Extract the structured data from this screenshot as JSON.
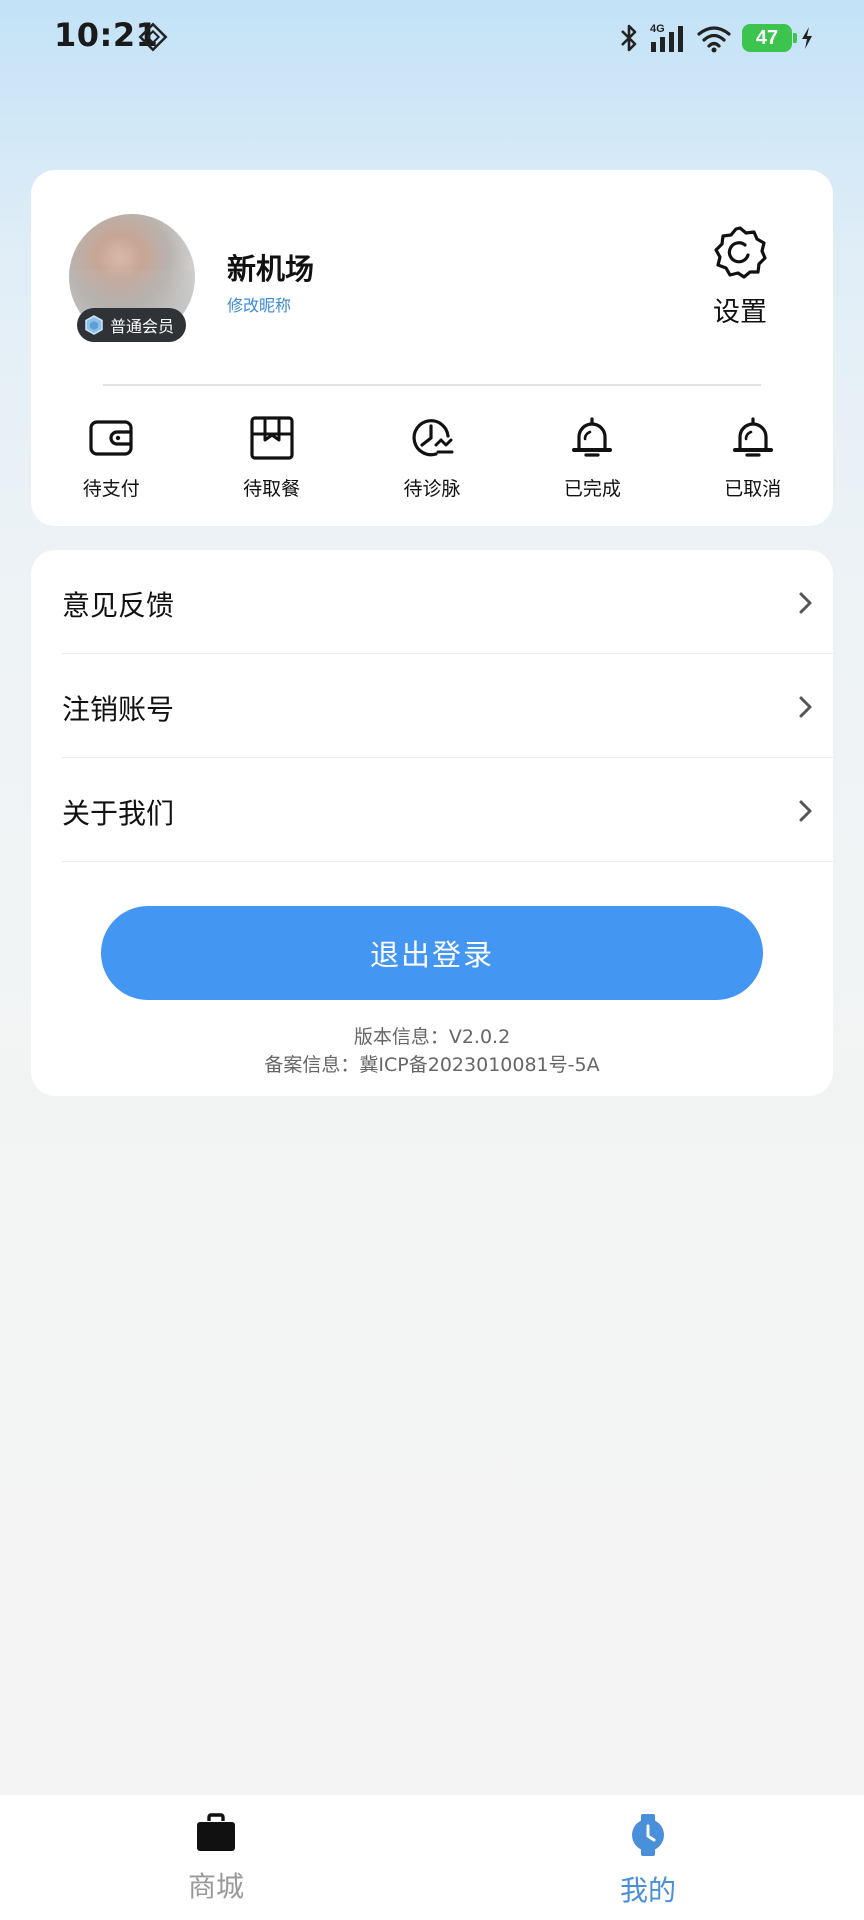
{
  "status_bar": {
    "time": "10:21",
    "network": "4G",
    "battery": "47",
    "icons": [
      "signal-extra-icon",
      "bluetooth-icon",
      "cellular-signal-icon",
      "wifi-icon",
      "battery-icon",
      "charging-icon"
    ]
  },
  "profile": {
    "nickname": "新机场",
    "edit_nickname": "修改昵称",
    "member_badge": "普通会员",
    "settings_label": "设置"
  },
  "orders": [
    {
      "label": "待支付",
      "icon": "wallet-icon"
    },
    {
      "label": "待取餐",
      "icon": "takeout-box-icon"
    },
    {
      "label": "待诊脉",
      "icon": "pulse-clock-icon"
    },
    {
      "label": "已完成",
      "icon": "bell-icon"
    },
    {
      "label": "已取消",
      "icon": "bell-icon"
    }
  ],
  "menu": {
    "items": [
      {
        "label": "意见反馈"
      },
      {
        "label": "注销账号"
      },
      {
        "label": "关于我们"
      }
    ],
    "logout_label": "退出登录",
    "version": "版本信息：V2.0.2",
    "icp": "备案信息：冀ICP备2023010081号-5A"
  },
  "tab_bar": {
    "tabs": [
      {
        "label": "商城",
        "icon": "shopping-bag-icon",
        "active": false
      },
      {
        "label": "我的",
        "icon": "watch-icon",
        "active": true
      }
    ]
  },
  "colors": {
    "accent": "#4496f3",
    "tab_active": "#4a8fd9",
    "tab_inactive": "#9a9a9a",
    "battery": "#3cc44f"
  }
}
